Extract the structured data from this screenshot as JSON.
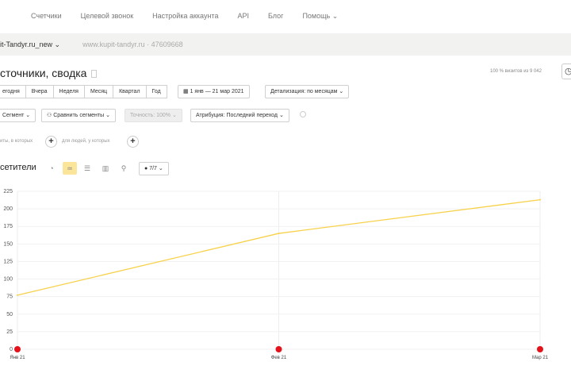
{
  "nav": {
    "items": [
      "Счетчики",
      "Целевой звонок",
      "Настройка аккаунта",
      "API",
      "Блог",
      "Помощь ⌄"
    ]
  },
  "counter": {
    "name": "it-Tandyr.ru_new ⌄",
    "site": "www.kupit-tandyr.ru · 47609668"
  },
  "page": {
    "title": "сточники, сводка",
    "visits_note": "100 % визитов из 9 042"
  },
  "periods": [
    "егодня",
    "Вчера",
    "Неделя",
    "Месяц",
    "Квартал",
    "Год"
  ],
  "date_range": "1 янв — 21 мар 2021",
  "detail": "Детализация: по месяцам ⌄",
  "segment": "Сегмент ⌄",
  "compare": "Сравнить сегменты ⌄",
  "accuracy": "Точность: 100% ⌄",
  "attribution": "Атрибуция: Последний переход ⌄",
  "filter": {
    "visits": "иты, в которых",
    "people": "для людей, у которых"
  },
  "chart_header": {
    "title": "сетители",
    "metrics_count": "7/7 ⌄"
  },
  "chart_data": {
    "type": "line",
    "x": [
      "Янв 21",
      "Фев 21",
      "Мар 21"
    ],
    "series": [
      {
        "name": "Посетители",
        "values": [
          77,
          165,
          213
        ],
        "color": "#f8d14a"
      }
    ],
    "ylim": [
      0,
      225
    ],
    "yticks": [
      0,
      25,
      50,
      75,
      100,
      125,
      150,
      175,
      200,
      225
    ],
    "ylabel": "",
    "xlabel": ""
  }
}
